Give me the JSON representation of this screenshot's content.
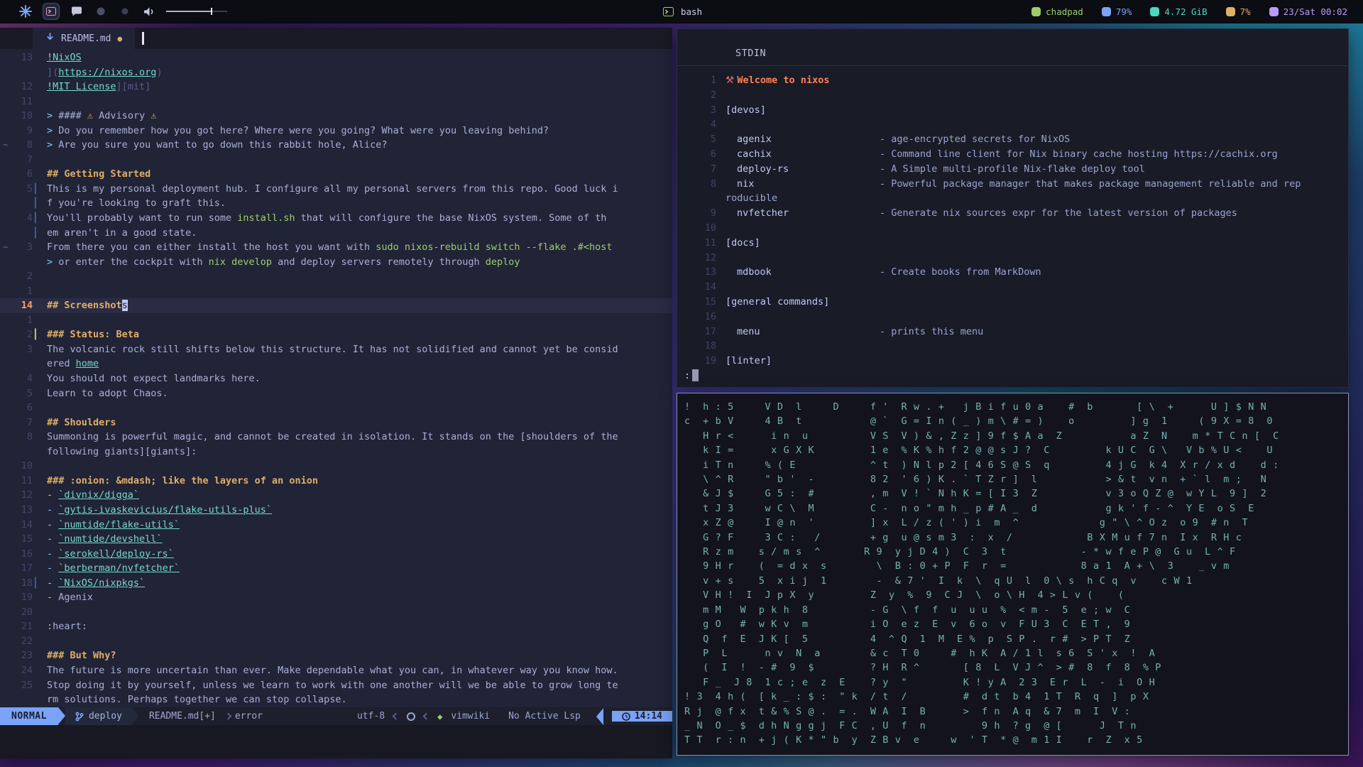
{
  "topbar": {
    "center_label": "bash",
    "right": [
      {
        "name": "vpn",
        "icon": "shield-icon",
        "label": "chadpad",
        "color": "#9ece6a"
      },
      {
        "name": "disk",
        "icon": "disk-icon",
        "label": "79%",
        "color": "#7aa2f7"
      },
      {
        "name": "memory",
        "icon": "memory-icon",
        "label": "4.72 GiB",
        "color": "#4fd6be"
      },
      {
        "name": "cpu",
        "icon": "cpu-icon",
        "label": "7%",
        "color": "#e0af68"
      },
      {
        "name": "clock",
        "icon": "calendar-clock-icon",
        "label": "23/Sat 00:02",
        "color": "#bb9af7"
      }
    ]
  },
  "editor": {
    "tab": {
      "filename": "README.md",
      "modified_dot": "●"
    },
    "rows": [
      {
        "n": "13",
        "segs": [
          [
            "!NixOS",
            "link"
          ]
        ]
      },
      {
        "segs": [
          [
            "](",
            "punc"
          ],
          [
            "https://nixos.org",
            "link"
          ],
          [
            ")",
            "punc"
          ]
        ]
      },
      {
        "n": "12",
        "segs": [
          [
            "!MIT License",
            "link"
          ],
          [
            "][mit]",
            "punc"
          ]
        ]
      },
      {
        "n": "11"
      },
      {
        "n": "10",
        "segs": [
          [
            "> ",
            "q"
          ],
          [
            "#### ",
            "t"
          ],
          [
            "⚠",
            "warn"
          ],
          [
            " Advisory ",
            "t"
          ],
          [
            "⚠",
            "warn"
          ]
        ]
      },
      {
        "n": "9",
        "segs": [
          [
            "> ",
            "q"
          ],
          [
            "Do you remember how you got here? Where were you going? What were you leaving behind?",
            "t"
          ]
        ]
      },
      {
        "n": "8",
        "tilde": "~",
        "segs": [
          [
            "> ",
            "q"
          ],
          [
            "Are you sure you want to go down this rabbit hole, Alice?",
            "t"
          ]
        ]
      },
      {
        "n": "7"
      },
      {
        "n": "6",
        "segs": [
          [
            "## Getting Started",
            "h"
          ]
        ]
      },
      {
        "n": "5",
        "sign": "▎",
        "signc": "sb",
        "segs": [
          [
            "This is my personal deployment hub. I configure all my personal servers from this repo. Good luck i",
            "t"
          ]
        ]
      },
      {
        "sign": "▎",
        "signc": "sb",
        "segs": [
          [
            "f you're looking to graft this.",
            "t"
          ]
        ]
      },
      {
        "n": "4",
        "sign": "▎",
        "signc": "sb",
        "segs": [
          [
            "You'll probably want to run some ",
            "t"
          ],
          [
            "install.sh",
            "code"
          ],
          [
            " that will configure the base NixOS system. Some of th",
            "t"
          ]
        ]
      },
      {
        "sign": "▎",
        "signc": "sb",
        "segs": [
          [
            "em aren't in a good state.",
            "t"
          ]
        ]
      },
      {
        "n": "3",
        "tilde": "~",
        "segs": [
          [
            "From there you can either install the host you want with ",
            "t"
          ],
          [
            "sudo nixos-rebuild switch --flake .#<host",
            "code"
          ]
        ]
      },
      {
        "segs": [
          [
            "> ",
            "brk"
          ],
          [
            "or enter the cockpit with ",
            "t"
          ],
          [
            "nix develop",
            "code"
          ],
          [
            " and deploy servers remotely through ",
            "t"
          ],
          [
            "deploy",
            "code"
          ]
        ]
      },
      {
        "n": "2"
      },
      {
        "n": "1"
      },
      {
        "n": "14",
        "cl": true,
        "segs": [
          [
            "## Screenshot",
            "h"
          ],
          [
            "s",
            "cur"
          ]
        ]
      },
      {
        "n": "1"
      },
      {
        "n": "2",
        "sign": "▎",
        "signc": "sg",
        "segs": [
          [
            "### Status: Beta",
            "h"
          ]
        ]
      },
      {
        "n": "3",
        "segs": [
          [
            "The volcanic rock still shifts below this structure. It has not solidified and cannot yet be consid",
            "t"
          ]
        ]
      },
      {
        "segs": [
          [
            "ered ",
            "t"
          ],
          [
            "home",
            "link"
          ]
        ]
      },
      {
        "n": "4",
        "segs": [
          [
            "You should not expect landmarks here.",
            "t"
          ]
        ]
      },
      {
        "n": "5",
        "segs": [
          [
            "Learn to adopt Chaos.",
            "t"
          ]
        ]
      },
      {
        "n": "6"
      },
      {
        "n": "7",
        "segs": [
          [
            "## Shoulders",
            "h"
          ]
        ]
      },
      {
        "n": "8",
        "segs": [
          [
            "Summoning is powerful magic, and cannot be created in isolation. It stands on the [shoulders of the",
            "t"
          ]
        ]
      },
      {
        "segs": [
          [
            "following giants][giants]:",
            "t"
          ]
        ]
      },
      {
        "n": "10"
      },
      {
        "n": "11",
        "segs": [
          [
            "### :onion: &mdash; like the layers of an onion",
            "h"
          ]
        ]
      },
      {
        "n": "12",
        "segs": [
          [
            "- ",
            "dash"
          ],
          [
            "`divnix/digga`",
            "link"
          ]
        ]
      },
      {
        "n": "13",
        "segs": [
          [
            "- ",
            "dash"
          ],
          [
            "`gytis-ivaskevicius/flake-utils-plus`",
            "link"
          ]
        ]
      },
      {
        "n": "14",
        "segs": [
          [
            "- ",
            "dash"
          ],
          [
            "`numtide/flake-utils`",
            "link"
          ]
        ]
      },
      {
        "n": "15",
        "segs": [
          [
            "- ",
            "dash"
          ],
          [
            "`numtide/devshell`",
            "link"
          ]
        ]
      },
      {
        "n": "16",
        "segs": [
          [
            "- ",
            "dash"
          ],
          [
            "`serokell/deploy-rs`",
            "link"
          ]
        ]
      },
      {
        "n": "17",
        "segs": [
          [
            "- ",
            "dash"
          ],
          [
            "`berberman/nvfetcher`",
            "link"
          ]
        ]
      },
      {
        "n": "18",
        "sign": "▎",
        "signc": "sb",
        "segs": [
          [
            "- ",
            "dash"
          ],
          [
            "`NixOS/nixpkgs`",
            "link"
          ]
        ]
      },
      {
        "n": "19",
        "segs": [
          [
            "- ",
            "dash"
          ],
          [
            "Agenix",
            "t"
          ]
        ]
      },
      {
        "n": "20"
      },
      {
        "n": "21",
        "segs": [
          [
            ":heart:",
            "t"
          ]
        ]
      },
      {
        "n": "22"
      },
      {
        "n": "23",
        "segs": [
          [
            "### But Why?",
            "h"
          ]
        ]
      },
      {
        "n": "24",
        "segs": [
          [
            "The future is more uncertain than ever. Make dependable what you can, in whatever way you know how.",
            "t"
          ]
        ]
      },
      {
        "n": "25",
        "segs": [
          [
            "Stop doing it by yourself, unless we learn to work with one another will we be able to grow long te",
            "t"
          ]
        ]
      },
      {
        "segs": [
          [
            "rm solutions. Perhaps together we can stop collapse.",
            "t"
          ]
        ]
      }
    ],
    "statusline": {
      "mode": "NORMAL",
      "branch": "deploy",
      "file": "README.md[+]",
      "diag": "error",
      "encoding": "utf-8",
      "filetype": "vimwiki",
      "lsp": "No Active Lsp",
      "time": "14:14"
    }
  },
  "terminal": {
    "title": "STDIN",
    "prompt": ":",
    "rows": [
      {
        "n": "1",
        "segs": [
          [
            "⚒ ",
            "wicon"
          ],
          [
            "Welcome to nixos",
            "welcome"
          ]
        ]
      },
      {
        "n": "2"
      },
      {
        "n": "3",
        "segs": [
          [
            "[devos]",
            "cat"
          ]
        ]
      },
      {
        "n": "4"
      },
      {
        "n": "5",
        "segs": [
          [
            "agenix",
            "name"
          ],
          [
            "- age-encrypted secrets for NixOS",
            "desc"
          ]
        ]
      },
      {
        "n": "6",
        "segs": [
          [
            "cachix",
            "name"
          ],
          [
            "- Command line client for Nix binary cache hosting https://cachix.org",
            "desc"
          ]
        ]
      },
      {
        "n": "7",
        "segs": [
          [
            "deploy-rs",
            "name"
          ],
          [
            "- A Simple multi-profile Nix-flake deploy tool",
            "desc"
          ]
        ]
      },
      {
        "n": "8",
        "segs": [
          [
            "nix",
            "name"
          ],
          [
            "- Powerful package manager that makes package management reliable and rep",
            "desc"
          ]
        ]
      },
      {
        "segs": [
          [
            "roducible",
            "wrapdesc"
          ]
        ]
      },
      {
        "n": "9",
        "segs": [
          [
            "nvfetcher",
            "name"
          ],
          [
            "- Generate nix sources expr for the latest version of packages",
            "desc"
          ]
        ]
      },
      {
        "n": "10"
      },
      {
        "n": "11",
        "segs": [
          [
            "[docs]",
            "cat"
          ]
        ]
      },
      {
        "n": "12"
      },
      {
        "n": "13",
        "segs": [
          [
            "mdbook",
            "name"
          ],
          [
            "- Create books from MarkDown",
            "desc"
          ]
        ]
      },
      {
        "n": "14"
      },
      {
        "n": "15",
        "segs": [
          [
            "[general commands]",
            "cat"
          ]
        ]
      },
      {
        "n": "16"
      },
      {
        "n": "17",
        "segs": [
          [
            "menu",
            "name"
          ],
          [
            "- prints this menu",
            "desc"
          ]
        ]
      },
      {
        "n": "18"
      },
      {
        "n": "19",
        "segs": [
          [
            "[linter]",
            "cat"
          ]
        ]
      }
    ]
  },
  "matrix": {
    "rows": [
      "!  h : 5     V D  l     D     f '  R w . +   j B i f u 0 a    #  b       [ \\  +      U ] $ N N",
      "c  + b V     4 B  t           @ `  G = I n ( _ ) m \\ # = )    o         ] g  1     ( 9 X = 8  0",
      "   H r <      i n  u          V S  V ) & , Z z ] 9 f $ A a  Z           a Z  N    m * T C n [  C",
      "   k I =      x G X K         1 e  % K % h f 2 @ @ s J ?  C         k U C  G \\   V b % U <    U",
      "   i T n     % ( E            ^ t  ) N l p 2 [ 4 6 S @ S  q         4 j G  k 4  X r / x d    d :",
      "   \\ ^ R     \" b '  -         8 2  ' 6 ) K . ` T Z r ]  l           > & t  v n  + ` l  m ;   N",
      "   & J $     G 5 :  #         , m  V ! ` N h K = [ I 3  Z           v 3 o Q Z @  w Y L  9 ]  2",
      "   t J 3     w C \\  M         C -  n o \" m h _ p # A _  d           g k ' f - ^  Y E  o S  E",
      "   x Z @     I @ n  '         ] x  L / z ( ' ) i  m  ^             g \" \\ ^ O z  o 9  # n  T",
      "   G ? F     3 C :   /        + g  u @ s m 3  :  x  /            B X M u f 7 n  I x  R H c",
      "   R z m    s / m s  ^       R 9  y j D 4 )  C  3  t            - * w f e P @  G u  L ^ F",
      "   9 H r    (  = d x  s        \\  B : 0 + P  F  r  =            8 a 1  A + \\  3    _ v m",
      "   v + s    5  x i j  1        -  & 7 '  I  k  \\  q U  l  0 \\ s  h C q  v    c W 1",
      "   V H !  I  J p X  y         Z  y  %  9  C J  \\  o \\ H  4 > L v (    (",
      "   m M   W  p k h  8          - G  \\ f  f  u  u u  %  < m -  5  e ; w  C",
      "   g O   #  w K v  m          i O  e z  E  v  6 o  v  F U 3  C  E T ,  9",
      "   Q  f  E  J K [  5          4  ^ Q  1  M  E %  p  S P .  r #  > P T  Z",
      "   P  L      n v  N  a        & c  T 0     #  h K  A / 1 l  s 6  S ' x  !  A",
      "   (  I  !  - #  9  $         ? H  R ^       [ 8  L  V J ^  > #  8  f  8  % P",
      "   F _  J 8  1 c ; e  z  E    ? y  \"         K ! y A  2 3  E r  L  -  i  O H",
      "! 3  4 h (  [ k _ : $ :  \" k  / t  /         #  d t  b 4  1 T  R  q  ]  p X",
      "R j  @ f x  t & % S @ .  = .  W A  I  B      >  f n  A q  & 7  m  I  V :",
      "_ N  O _ $  d h N g g j  F C  , U  f  n         9 h  ? g  @ [      J  T n",
      "T T  r : n  + j ( K * \" b  y  Z B v  e     w  ' T  * @  m 1 I    r  Z  x 5"
    ]
  }
}
